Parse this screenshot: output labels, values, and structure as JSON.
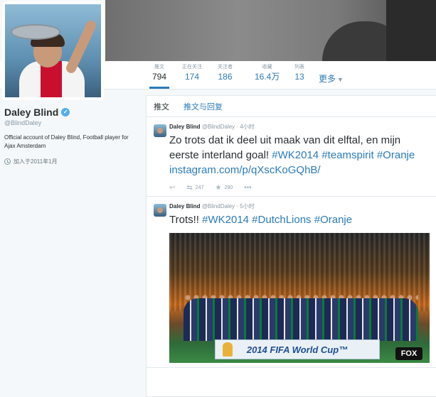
{
  "profile": {
    "name": "Daley Blind",
    "handle": "@BlindDaley",
    "bio": "Official account of Daley Blind, Football player for Ajax Amsterdam",
    "joined": "加入于2011年1月"
  },
  "stats": [
    {
      "label": "推文",
      "value": "794"
    },
    {
      "label": "正在关注",
      "value": "174"
    },
    {
      "label": "关注者",
      "value": "186"
    },
    {
      "label": "收藏",
      "value": "16.4万"
    },
    {
      "label": "列表",
      "value": "13"
    }
  ],
  "more_label": "更多",
  "tabs": {
    "tweets": "推文",
    "replies": "推文与回复"
  },
  "tweets": [
    {
      "name": "Daley Blind",
      "handle": "@BlindDaley",
      "time": "· 4小时",
      "text_plain": "Zo trots dat ik deel uit maak van dit elftal, en mijn eerste interland goal!",
      "hashtags": [
        "#WK2014",
        "#teamspirit",
        "#Oranje"
      ],
      "link": "instagram.com/p/qXscKoGQhB/",
      "retweets": "247",
      "favorites": "290"
    },
    {
      "name": "Daley Blind",
      "handle": "@BlindDaley",
      "time": "· 5小时",
      "text_plain": "Trots!!",
      "hashtags": [
        "#WK2014",
        "#DutchLions",
        "#Oranje"
      ],
      "photo_banner": "2014 FIFA World Cup™",
      "photo_watermark": "FOX"
    }
  ],
  "icons": {
    "verified": "verified-badge-icon",
    "reply": "reply-icon",
    "retweet": "retweet-icon",
    "favorite": "star-icon",
    "more": "ellipsis-icon",
    "joined": "clock-icon"
  },
  "colors": {
    "link": "#2b7bb9",
    "verified": "#55acee",
    "muted": "#8899a6"
  }
}
